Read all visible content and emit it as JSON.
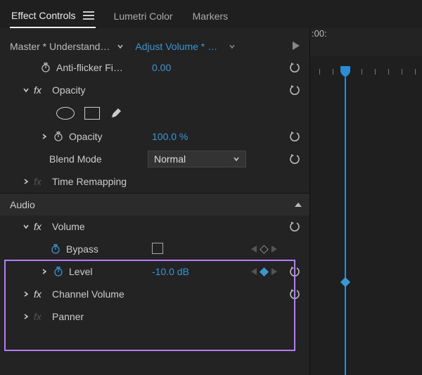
{
  "tabs": {
    "effect_controls": "Effect Controls",
    "lumetri_color": "Lumetri Color",
    "markers": "Markers"
  },
  "header": {
    "master_label": "Master * Understand…",
    "clip_label": "Adjust Volume * …",
    "timecode": ":00:"
  },
  "effects": {
    "antiflicker": {
      "label": "Anti-flicker Fi…",
      "value": "0.00"
    },
    "opacity_group": {
      "label": "Opacity"
    },
    "opacity_prop": {
      "label": "Opacity",
      "value": "100.0 %"
    },
    "blend_mode": {
      "label": "Blend Mode",
      "value": "Normal"
    },
    "time_remapping": {
      "label": "Time Remapping"
    }
  },
  "audio": {
    "section": "Audio",
    "volume_group": "Volume",
    "bypass": {
      "label": "Bypass"
    },
    "level": {
      "label": "Level",
      "value": "-10.0 dB"
    },
    "channel_volume": "Channel Volume",
    "panner": "Panner"
  }
}
